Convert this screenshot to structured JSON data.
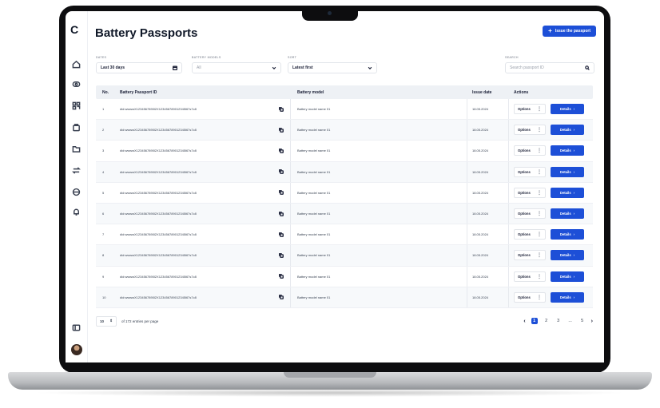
{
  "sidebar": {
    "logo": "C",
    "icons": [
      "home-icon",
      "coin-icon",
      "qr-icon",
      "bag-icon",
      "folder-icon",
      "swap-icon",
      "settings-icon",
      "bell-icon"
    ],
    "bottom_icon": "panel-icon"
  },
  "header": {
    "title": "Battery Passports",
    "issue_button": "Issue the passport"
  },
  "filters": {
    "dates_label": "DATES",
    "dates_value": "Last 30 days",
    "models_label": "BATTERY MODELS",
    "models_value": "All",
    "sort_label": "SORT",
    "sort_value": "Latest first",
    "search_label": "SEARCH",
    "search_placeholder": "Search passport ID"
  },
  "table": {
    "columns": [
      "No.",
      "Battery Passport ID",
      "Battery model",
      "Issue date",
      "Actions"
    ],
    "rows": [
      {
        "no": "1",
        "id": "did:wwwwX1234567890l2X123456789012345l67s7c8",
        "model": "Battery model name 01",
        "date": "18.05.2024"
      },
      {
        "no": "2",
        "id": "did:wwwwX1234567890l2X123456789012345l67s7c8",
        "model": "Battery model name 01",
        "date": "18.05.2024"
      },
      {
        "no": "3",
        "id": "did:wwwwX1234567890l2X123456789012345l67s7c8",
        "model": "Battery model name 01",
        "date": "18.05.2024"
      },
      {
        "no": "4",
        "id": "did:wwwwX1234567890l2X123456789012345l67s7c8",
        "model": "Battery model name 01",
        "date": "18.05.2024"
      },
      {
        "no": "5",
        "id": "did:wwwwX1234567890l2X123456789012345l67s7c8",
        "model": "Battery model name 01",
        "date": "18.05.2024"
      },
      {
        "no": "6",
        "id": "did:wwwwX1234567890l2X123456789012345l67s7c8",
        "model": "Battery model name 01",
        "date": "18.05.2024"
      },
      {
        "no": "7",
        "id": "did:wwwwX1234567890l2X123456789012345l67s7c8",
        "model": "Battery model name 01",
        "date": "18.05.2024"
      },
      {
        "no": "8",
        "id": "did:wwwwX1234567890l2X123456789012345l67s7c8",
        "model": "Battery model name 01",
        "date": "18.05.2024"
      },
      {
        "no": "9",
        "id": "did:wwwwX1234567890l2X123456789012345l67s7c8",
        "model": "Battery model name 01",
        "date": "18.05.2024"
      },
      {
        "no": "10",
        "id": "did:wwwwX1234567890l2X123456789012345l67s7c8",
        "model": "Battery model name 01",
        "date": "18.05.2024"
      }
    ],
    "options_label": "Options",
    "details_label": "Details"
  },
  "footer": {
    "per_page": "10",
    "entries_text": "of 172 entries per page",
    "pages": [
      "1",
      "2",
      "3",
      "...",
      "5"
    ],
    "active_page": "1"
  },
  "colors": {
    "accent": "#1d4fd7",
    "header_bg": "#eef1f5",
    "text": "#1a1f36"
  }
}
